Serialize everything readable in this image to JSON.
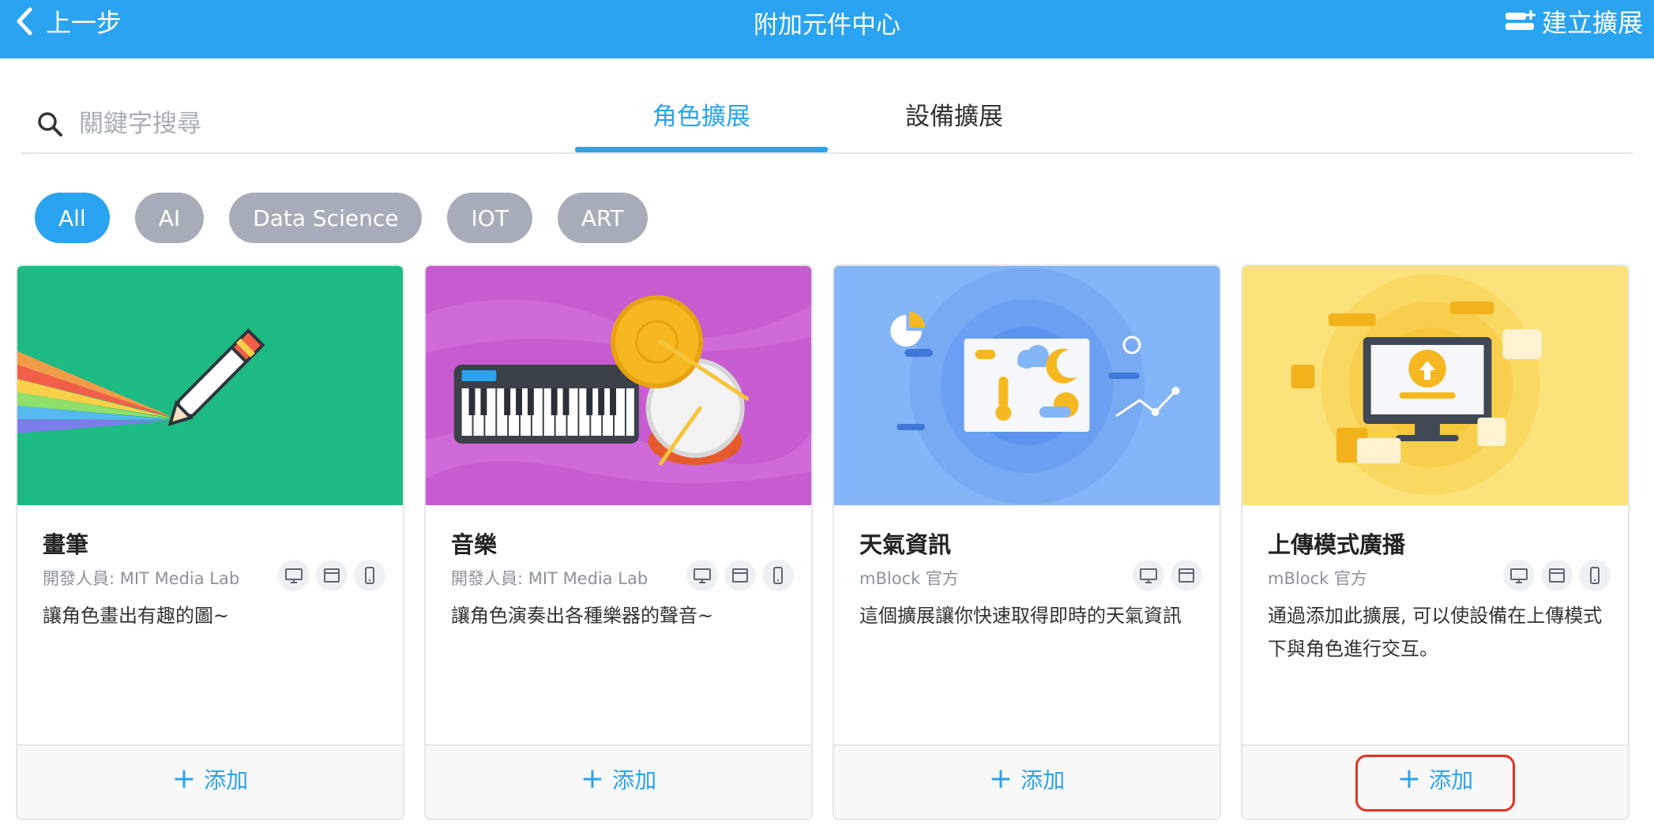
{
  "header": {
    "back_label": "上一步",
    "title": "附加元件中心",
    "create_label": "建立擴展"
  },
  "search": {
    "placeholder": "關鍵字搜尋"
  },
  "tabs": [
    {
      "label": "角色擴展",
      "active": true
    },
    {
      "label": "設備擴展",
      "active": false
    }
  ],
  "categories": [
    {
      "label": "All",
      "active": true
    },
    {
      "label": "AI",
      "active": false
    },
    {
      "label": "Data Science",
      "active": false
    },
    {
      "label": "IOT",
      "active": false
    },
    {
      "label": "ART",
      "active": false
    }
  ],
  "cards": [
    {
      "name": "畫筆",
      "author": "開發人員: MIT Media Lab",
      "desc": "讓角色畫出有趣的圖~",
      "platforms": [
        "desktop-icon",
        "browser-icon",
        "mobile-icon"
      ],
      "add_label": "添加",
      "image_bg": "#1dba83"
    },
    {
      "name": "音樂",
      "author": "開發人員: MIT Media Lab",
      "desc": "讓角色演奏出各種樂器的聲音~",
      "platforms": [
        "desktop-icon",
        "browser-icon",
        "mobile-icon"
      ],
      "add_label": "添加",
      "image_bg": "#c65cd0"
    },
    {
      "name": "天氣資訊",
      "author": "mBlock 官方",
      "desc": "這個擴展讓你快速取得即時的天氣資訊",
      "platforms": [
        "desktop-icon",
        "browser-icon"
      ],
      "add_label": "添加",
      "image_bg": "#83b5f7"
    },
    {
      "name": "上傳模式廣播",
      "author": "mBlock 官方",
      "desc": "通過添加此擴展, 可以使設備在上傳模式下與角色進行交互。",
      "platforms": [
        "desktop-icon",
        "browser-icon",
        "mobile-icon"
      ],
      "add_label": "添加",
      "image_bg": "#fbe27a"
    }
  ],
  "colors": {
    "primary": "#2aa3f0",
    "chip_inactive": "#a7adb8",
    "highlight": "#e8321d"
  }
}
